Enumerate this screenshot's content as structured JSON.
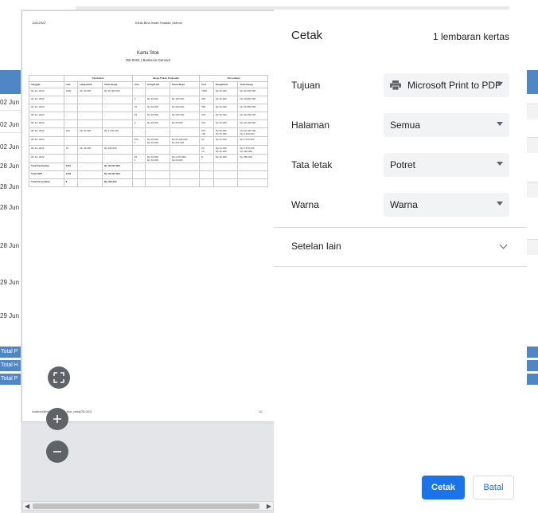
{
  "background": {
    "rows": [
      "02 Jun",
      "02 Jun",
      "02 Jun",
      "28 Jun",
      "28 Jun",
      "28 Jun",
      "28 Jun",
      "29 Jun",
      "29 Jun"
    ],
    "totals": [
      "Total P",
      "Total H",
      "Total P"
    ]
  },
  "preview": {
    "date": "11/6/2020",
    "site": "Klinik Bina Insan Husada | Admin",
    "title": "Kartu Stok",
    "subtitle": "OB-0001 | Bodrexin Demam",
    "group_headers": [
      "Pembelian",
      "Harga Pokok Penjualan",
      "Persediaan"
    ],
    "col_headers": [
      "Tanggal",
      "Unit",
      "Harga/Unit",
      "Total Harga",
      "Unit",
      "Harga/Unit",
      "Total Harga",
      "Unit",
      "Harga/Unit",
      "Total Harga"
    ],
    "rows": [
      [
        "02 Jun 2020",
        "1000",
        "Rp 30.000",
        "Rp 30.000.000",
        "-",
        "-",
        "-",
        "1000",
        "Rp 30.000",
        "Rp 30.000.000"
      ],
      [
        "02 Jun 2020",
        "-",
        "-",
        "-",
        "5",
        "Rp 30.000",
        "Rp 150.000",
        "995",
        "Rp 30.000",
        "Rp 29.850.000"
      ],
      [
        "02 Jun 2020",
        "-",
        "-",
        "-",
        "10",
        "Rp 30.000",
        "Rp 300.000",
        "985",
        "Rp 30.000",
        "Rp 29.550.000"
      ],
      [
        "08 Jun 2020",
        "-",
        "-",
        "-",
        "10",
        "Rp 30.000",
        "Rp 300.000",
        "975",
        "Rp 30.000",
        "Rp 29.250.000"
      ],
      [
        "08 Jun 2020",
        "-",
        "-",
        "-",
        "2",
        "Rp 30.000",
        "Rp 60.000",
        "973",
        "Rp 30.000",
        "Rp 29.190.000"
      ],
      [
        "08 Jun 2020",
        "100",
        "Rp 32.000",
        "Rp 3.200.000",
        "-",
        "-",
        "-",
        "973 / 100",
        "Rp 30.000 / Rp 32.000",
        "Rp 29.190.000 / Rp 3.200.000"
      ],
      [
        "08 Jun 2020",
        "-",
        "-",
        "-",
        "973 / 7",
        "Rp 30.000 / Rp 32.000",
        "Rp 29.190.000 / Rp 224.000",
        "93",
        "Rp 32.000",
        "Rp 2.976.000"
      ],
      [
        "08 Jun 2020",
        "10",
        "Rp 32.000",
        "Rp 320.000",
        "-",
        "-",
        "-",
        "93 / 10",
        "Rp 32.000 / Rp 32.000",
        "Rp 2.976.000 / Rp 320.000"
      ],
      [
        "09 Jun 2020",
        "-",
        "-",
        "-",
        "93 / 2",
        "Rp 32.000 / Rp 32.000",
        "Rp 2.976.000 / Rp 64.000",
        "8",
        "Rp 32.000",
        "Rp 256.000"
      ]
    ],
    "total_rows": [
      [
        "Total Pembelian",
        "1110",
        "-",
        "Rp 33.520.000"
      ],
      [
        "Total HPP",
        "1102",
        "-",
        "Rp 33.264.000"
      ],
      [
        "Total Persediaan",
        "8",
        "-",
        "Rp 256.000"
      ]
    ],
    "footer_url": "localhost/klinik/admin/kartu_stok_cetak/OB-0001",
    "footer_page": "1/1"
  },
  "panel": {
    "title": "Cetak",
    "sheets": "1 lembaran kertas",
    "destination_label": "Tujuan",
    "destination_value": "Microsoft Print to PDF",
    "pages_label": "Halaman",
    "pages_value": "Semua",
    "layout_label": "Tata letak",
    "layout_value": "Potret",
    "color_label": "Warna",
    "color_value": "Warna",
    "more_settings": "Setelan lain",
    "print_button": "Cetak",
    "cancel_button": "Batal"
  },
  "colors": {
    "accent": "#1a73e8",
    "background_table_header": "#4f86c6"
  },
  "icons": [
    "printer-icon",
    "fit-to-page-icon",
    "zoom-in-icon",
    "zoom-out-icon",
    "chevron-down-icon"
  ]
}
